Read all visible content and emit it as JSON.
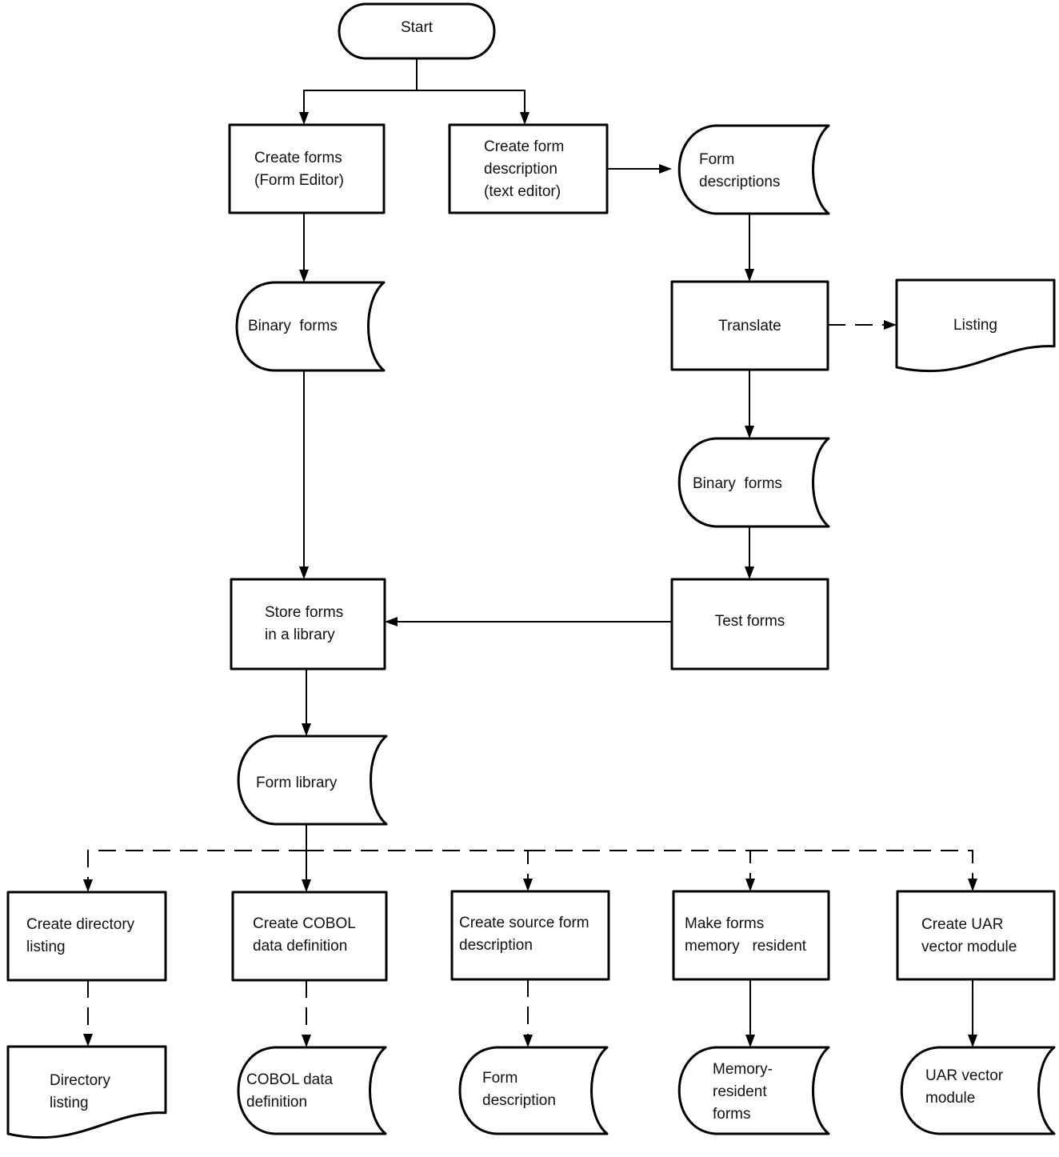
{
  "diagram": {
    "type": "flowchart",
    "nodes": [
      {
        "id": "start",
        "shape": "terminal",
        "lines": [
          "Start"
        ]
      },
      {
        "id": "create-forms",
        "shape": "process",
        "lines": [
          "Create forms",
          "(Form Editor)"
        ]
      },
      {
        "id": "create-form-description",
        "shape": "process",
        "lines": [
          "Create form",
          "description",
          "(text editor)"
        ]
      },
      {
        "id": "form-descriptions",
        "shape": "storage",
        "lines": [
          "Form",
          "descriptions"
        ]
      },
      {
        "id": "binary-forms-left",
        "shape": "storage",
        "lines": [
          "Binary  forms"
        ]
      },
      {
        "id": "translate",
        "shape": "process",
        "lines": [
          "Translate"
        ]
      },
      {
        "id": "listing",
        "shape": "document",
        "lines": [
          "Listing"
        ]
      },
      {
        "id": "binary-forms-right",
        "shape": "storage",
        "lines": [
          "Binary  forms"
        ]
      },
      {
        "id": "store-forms",
        "shape": "process",
        "lines": [
          "Store forms",
          "in a library"
        ]
      },
      {
        "id": "test-forms",
        "shape": "process",
        "lines": [
          "Test forms"
        ]
      },
      {
        "id": "form-library",
        "shape": "storage",
        "lines": [
          "Form library"
        ]
      },
      {
        "id": "create-directory-listing",
        "shape": "process",
        "lines": [
          "Create directory",
          "listing"
        ]
      },
      {
        "id": "create-cobol",
        "shape": "process",
        "lines": [
          "Create COBOL",
          "data definition"
        ]
      },
      {
        "id": "create-source-form",
        "shape": "process",
        "lines": [
          "Create source form",
          "description"
        ]
      },
      {
        "id": "make-memory-resident",
        "shape": "process",
        "lines": [
          "Make forms",
          "memory   resident"
        ]
      },
      {
        "id": "create-uar",
        "shape": "process",
        "lines": [
          "Create UAR",
          "vector module"
        ]
      },
      {
        "id": "directory-listing",
        "shape": "document",
        "lines": [
          "Directory",
          "listing"
        ]
      },
      {
        "id": "cobol-data-definition",
        "shape": "storage",
        "lines": [
          "COBOL data",
          "definition"
        ]
      },
      {
        "id": "form-description",
        "shape": "storage",
        "lines": [
          "Form",
          "description"
        ]
      },
      {
        "id": "memory-resident-forms",
        "shape": "storage",
        "lines": [
          "Memory-",
          "resident",
          "forms"
        ]
      },
      {
        "id": "uar-vector-module",
        "shape": "storage",
        "lines": [
          "UAR vector",
          "module"
        ]
      }
    ],
    "edges": [
      {
        "from": "start",
        "to": "create-forms",
        "style": "solid"
      },
      {
        "from": "start",
        "to": "create-form-description",
        "style": "solid"
      },
      {
        "from": "create-form-description",
        "to": "form-descriptions",
        "style": "solid"
      },
      {
        "from": "create-forms",
        "to": "binary-forms-left",
        "style": "solid"
      },
      {
        "from": "form-descriptions",
        "to": "translate",
        "style": "solid"
      },
      {
        "from": "translate",
        "to": "listing",
        "style": "dashed"
      },
      {
        "from": "translate",
        "to": "binary-forms-right",
        "style": "solid"
      },
      {
        "from": "binary-forms-right",
        "to": "test-forms",
        "style": "solid"
      },
      {
        "from": "binary-forms-left",
        "to": "store-forms",
        "style": "solid"
      },
      {
        "from": "test-forms",
        "to": "store-forms",
        "style": "solid"
      },
      {
        "from": "store-forms",
        "to": "form-library",
        "style": "solid"
      },
      {
        "from": "form-library",
        "to": "create-directory-listing",
        "style": "dashed"
      },
      {
        "from": "form-library",
        "to": "create-cobol",
        "style": "solid"
      },
      {
        "from": "form-library",
        "to": "create-source-form",
        "style": "dashed"
      },
      {
        "from": "form-library",
        "to": "make-memory-resident",
        "style": "dashed"
      },
      {
        "from": "form-library",
        "to": "create-uar",
        "style": "dashed"
      },
      {
        "from": "create-directory-listing",
        "to": "directory-listing",
        "style": "dashed"
      },
      {
        "from": "create-cobol",
        "to": "cobol-data-definition",
        "style": "dashed"
      },
      {
        "from": "create-source-form",
        "to": "form-description",
        "style": "dashed"
      },
      {
        "from": "make-memory-resident",
        "to": "memory-resident-forms",
        "style": "solid"
      },
      {
        "from": "create-uar",
        "to": "uar-vector-module",
        "style": "solid"
      }
    ]
  }
}
